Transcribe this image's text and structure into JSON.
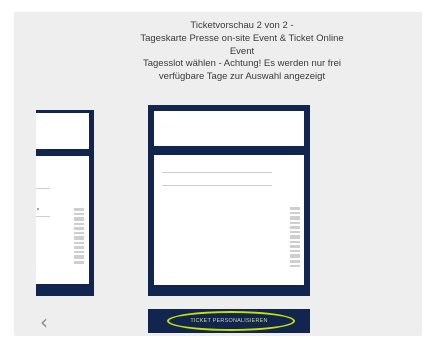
{
  "header": {
    "title_lines": [
      "Ticketvorschau 2 von 2 -",
      "Tageskarte Presse on-site Event & Ticket Online",
      "Event",
      "Tagesslot wählen - Achtung! Es werden nur frei",
      "verfügbare Tage zur Auswahl angezeigt"
    ]
  },
  "carousel": {
    "prev_icon": "chevron-left-icon",
    "prev_glyph": "‹"
  },
  "actions": {
    "personalize_label": "TICKET PERSONALISIEREN"
  },
  "colors": {
    "ticket_navy": "#11254e",
    "panel_bg": "#eeeeee",
    "highlight": "#c8e000"
  }
}
